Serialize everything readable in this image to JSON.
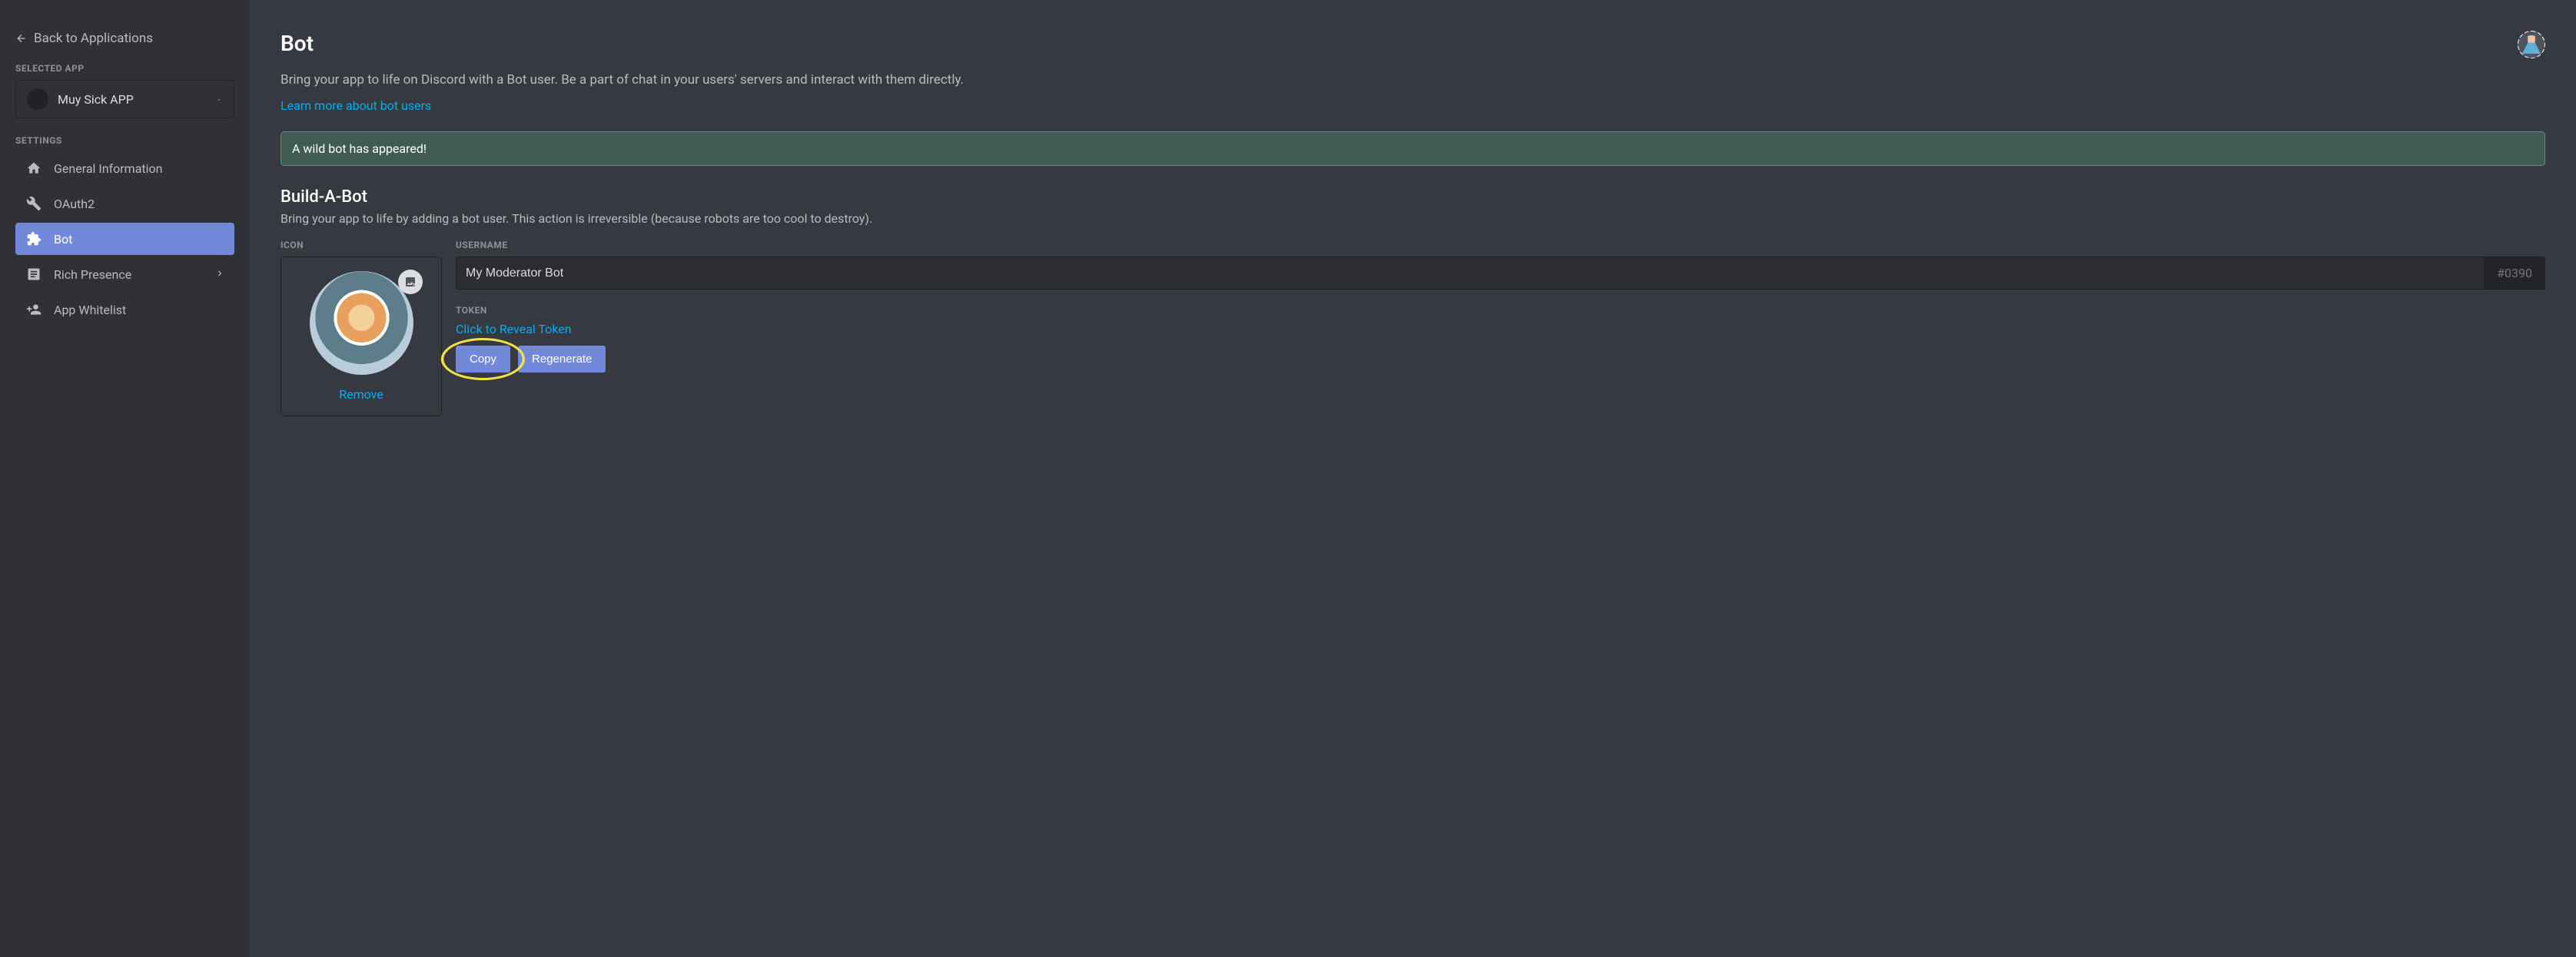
{
  "sidebar": {
    "back_label": "Back to Applications",
    "selected_app_label": "SELECTED APP",
    "selected_app_name": "Muy Sick APP",
    "settings_label": "SETTINGS",
    "nav": {
      "general": "General Information",
      "oauth2": "OAuth2",
      "bot": "Bot",
      "rich_presence": "Rich Presence",
      "app_whitelist": "App Whitelist"
    }
  },
  "page": {
    "title": "Bot",
    "description": "Bring your app to life on Discord with a Bot user. Be a part of chat in your users' servers and interact with them directly.",
    "learn_more": "Learn more about bot users",
    "banner": "A wild bot has appeared!"
  },
  "build": {
    "title": "Build-A-Bot",
    "description": "Bring your app to life by adding a bot user. This action is irreversible (because robots are too cool to destroy).",
    "icon_label": "ICON",
    "remove_label": "Remove",
    "username_label": "USERNAME",
    "username_value": "My Moderator Bot",
    "discriminator": "#0390",
    "token_label": "TOKEN",
    "token_reveal": "Click to Reveal Token",
    "copy_label": "Copy",
    "regenerate_label": "Regenerate"
  }
}
